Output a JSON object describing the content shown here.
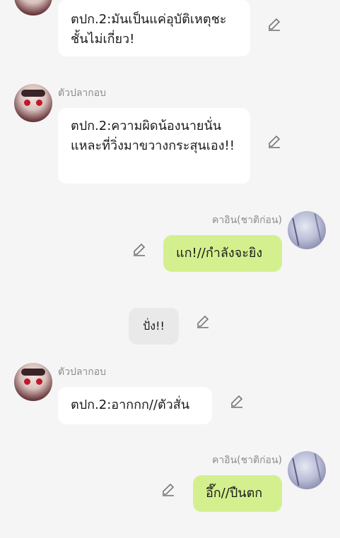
{
  "messages": [
    {
      "type": "other",
      "text": "ตปก.2:มันเป็นแค่อุบัติเหตุชะ ชั้นไม่เกี่ยว!"
    },
    {
      "type": "other",
      "sender": "ตัวปลากอบ",
      "text": "ตปก.2:ความผิดน้องนายนั่นแหละที่วิ่งมาขวางกระสุนเอง!!"
    },
    {
      "type": "self",
      "sender": "คาอิน(ชาติก่อน)",
      "text": "แก!//กำลังจะยิง"
    },
    {
      "type": "narration",
      "text": "ปั่ง!!"
    },
    {
      "type": "other",
      "sender": "ตัวปลากอบ",
      "text": "ตปก.2:อากกก//ตัวสั่น"
    },
    {
      "type": "self",
      "sender": "คาอิน(ชาติก่อน)",
      "text": "อึ๊ก//ปืนตก"
    }
  ],
  "colors": {
    "background": "#f5f5f5",
    "self_bubble": "#d4f08e",
    "other_bubble": "#ffffff",
    "narration_bubble": "#e9e9e9"
  },
  "icons": {
    "edit": "pencil-edit-icon",
    "avatar_other": "anime-avatar-red-eyes",
    "avatar_self": "anime-avatar-sketch"
  }
}
